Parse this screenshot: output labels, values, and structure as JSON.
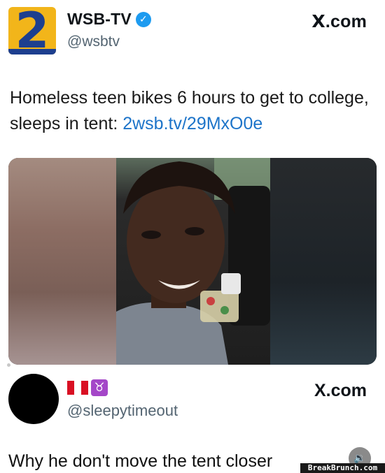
{
  "post1": {
    "avatar_number": "2",
    "display_name": "WSB-TV",
    "verified_mark": "✓",
    "handle": "@wsbtv",
    "source_label": ".com",
    "source_x": "X",
    "text": "Homeless teen bikes 6 hours to get to college, sleeps in tent: ",
    "link": "2wsb.tv/29MxO0e",
    "media": {
      "icon": "video-thumbnail"
    }
  },
  "post2": {
    "handle": "@sleepytimeout",
    "flag": "peru-flag-icon",
    "zodiac_symbol": "♉",
    "source_label": ".com",
    "source_x": "X",
    "text": "Why he don't move the tent closer"
  },
  "sound_button_icon": "🔉",
  "watermark": "BreakBrunch.com",
  "colors": {
    "verified": "#1d9bf0",
    "link": "#1d74c9",
    "wsb_yellow": "#f2b51a",
    "wsb_blue": "#1d3f8f",
    "taurus": "#a447c8"
  }
}
